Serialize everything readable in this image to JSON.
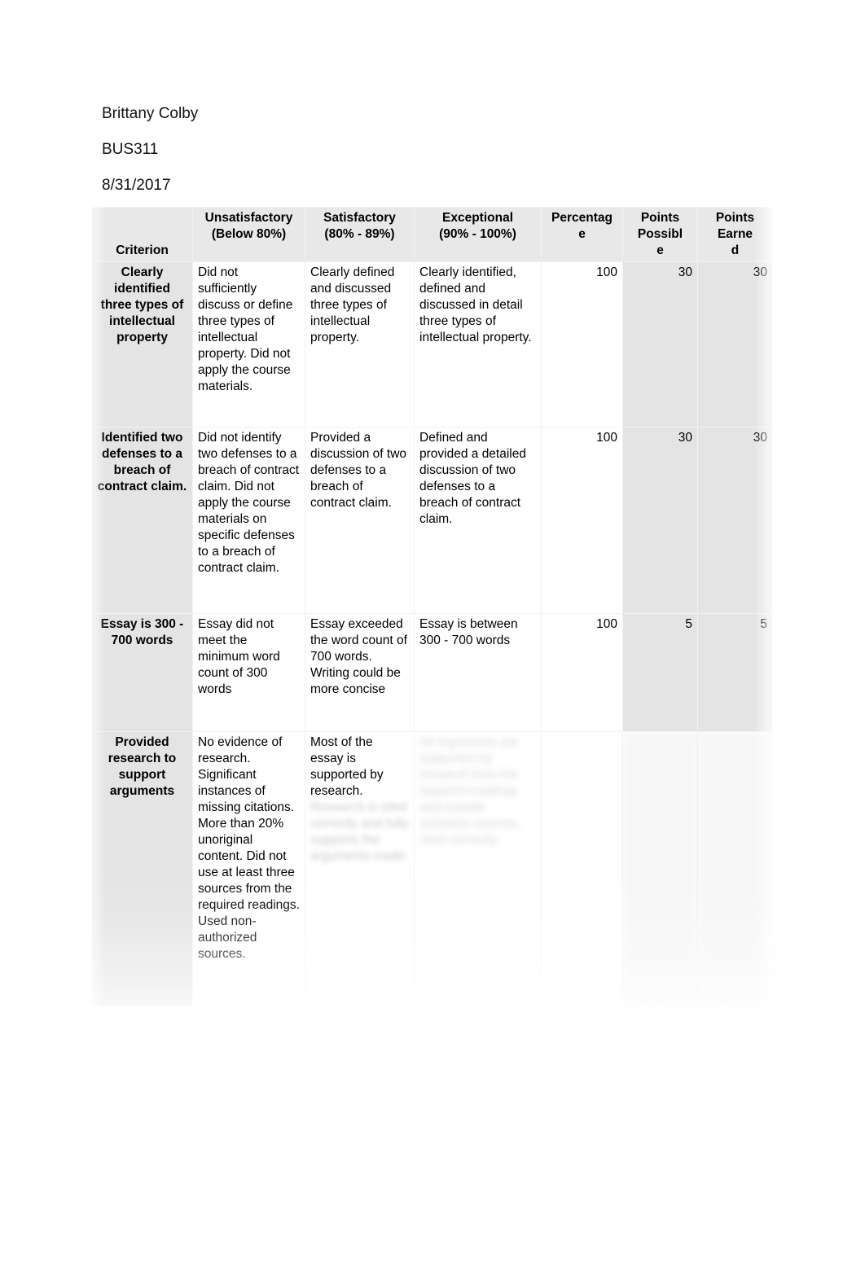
{
  "document": {
    "header_lines": [
      "Brittany Colby",
      "BUS311",
      "8/31/2017"
    ]
  },
  "table": {
    "headers": [
      "Criterion",
      "Unsatisfactory (Below 80%)",
      "Satisfactory (80% - 89%)",
      "Exceptional (90% - 100%)",
      "Percentage",
      "Points Possible",
      "Points Earned"
    ],
    "headers_wrapped": {
      "criterion": "Criterion",
      "unsatisfactory_l1": "Unsatisfactory",
      "unsatisfactory_l2": "(Below 80%)",
      "satisfactory_l1": "Satisfactory",
      "satisfactory_l2": "(80% - 89%)",
      "exceptional_l1": "Exceptional",
      "exceptional_l2": "(90% - 100%)",
      "percentage_l1": "Percentag",
      "percentage_l2": "e",
      "points_possible_l1": "Points",
      "points_possible_l2": "Possibl",
      "points_possible_l3": "e",
      "points_earned_l1": "Points",
      "points_earned_l2": "Earne",
      "points_earned_l3": "d"
    },
    "rows": [
      {
        "criterion": "Clearly identified three types of intellectual property",
        "unsatisfactory": "Did not sufficiently discuss or define three types of intellectual property.  Did not apply the course materials.",
        "satisfactory": "Clearly defined and discussed three types of intellectual property.",
        "exceptional": "Clearly identified, defined and discussed in detail three types of intellectual property.",
        "percentage": "100",
        "points_possible": "30",
        "points_earned": "30"
      },
      {
        "criterion": "Identified two defenses to a breach of contract claim.",
        "unsatisfactory": "Did not identify two defenses to a breach of contract claim. Did not apply the course materials on specific defenses to a breach of contract claim.",
        "satisfactory": "Provided a discussion of two defenses to a breach of contract claim.",
        "exceptional": "Defined and provided a detailed discussion of two defenses to a breach of contract claim.",
        "percentage": "100",
        "points_possible": "30",
        "points_earned": "30"
      },
      {
        "criterion": "Essay is 300 - 700 words",
        "unsatisfactory": "Essay did not meet the minimum word count of 300 words",
        "satisfactory": "Essay exceeded the word count of 700 words. Writing could be more concise",
        "exceptional": "Essay is between 300 - 700 words",
        "percentage": "100",
        "points_possible": "5",
        "points_earned": "5"
      },
      {
        "criterion": "Provided research to support arguments",
        "unsatisfactory": "No evidence of research. Significant instances of missing citations. More than 20% unoriginal content.  Did not use at least three sources from the required readings. Used non-authorized sources.",
        "satisfactory": "Most of the essay is supported by research.",
        "satisfactory_faded": "Research is cited correctly and fully supports the arguments made.",
        "exceptional_faded": "All arguments are supported by research from the required readings and outside scholarly sources, cited correctly.",
        "percentage": "",
        "points_possible": "",
        "points_earned": ""
      }
    ]
  },
  "colors": {
    "page_background": "#ffffff",
    "shaded_cell": "#e4e4e4",
    "header_cell": "#e8e8e8",
    "grid_line": "#f2f2f2",
    "text": "#000000"
  }
}
